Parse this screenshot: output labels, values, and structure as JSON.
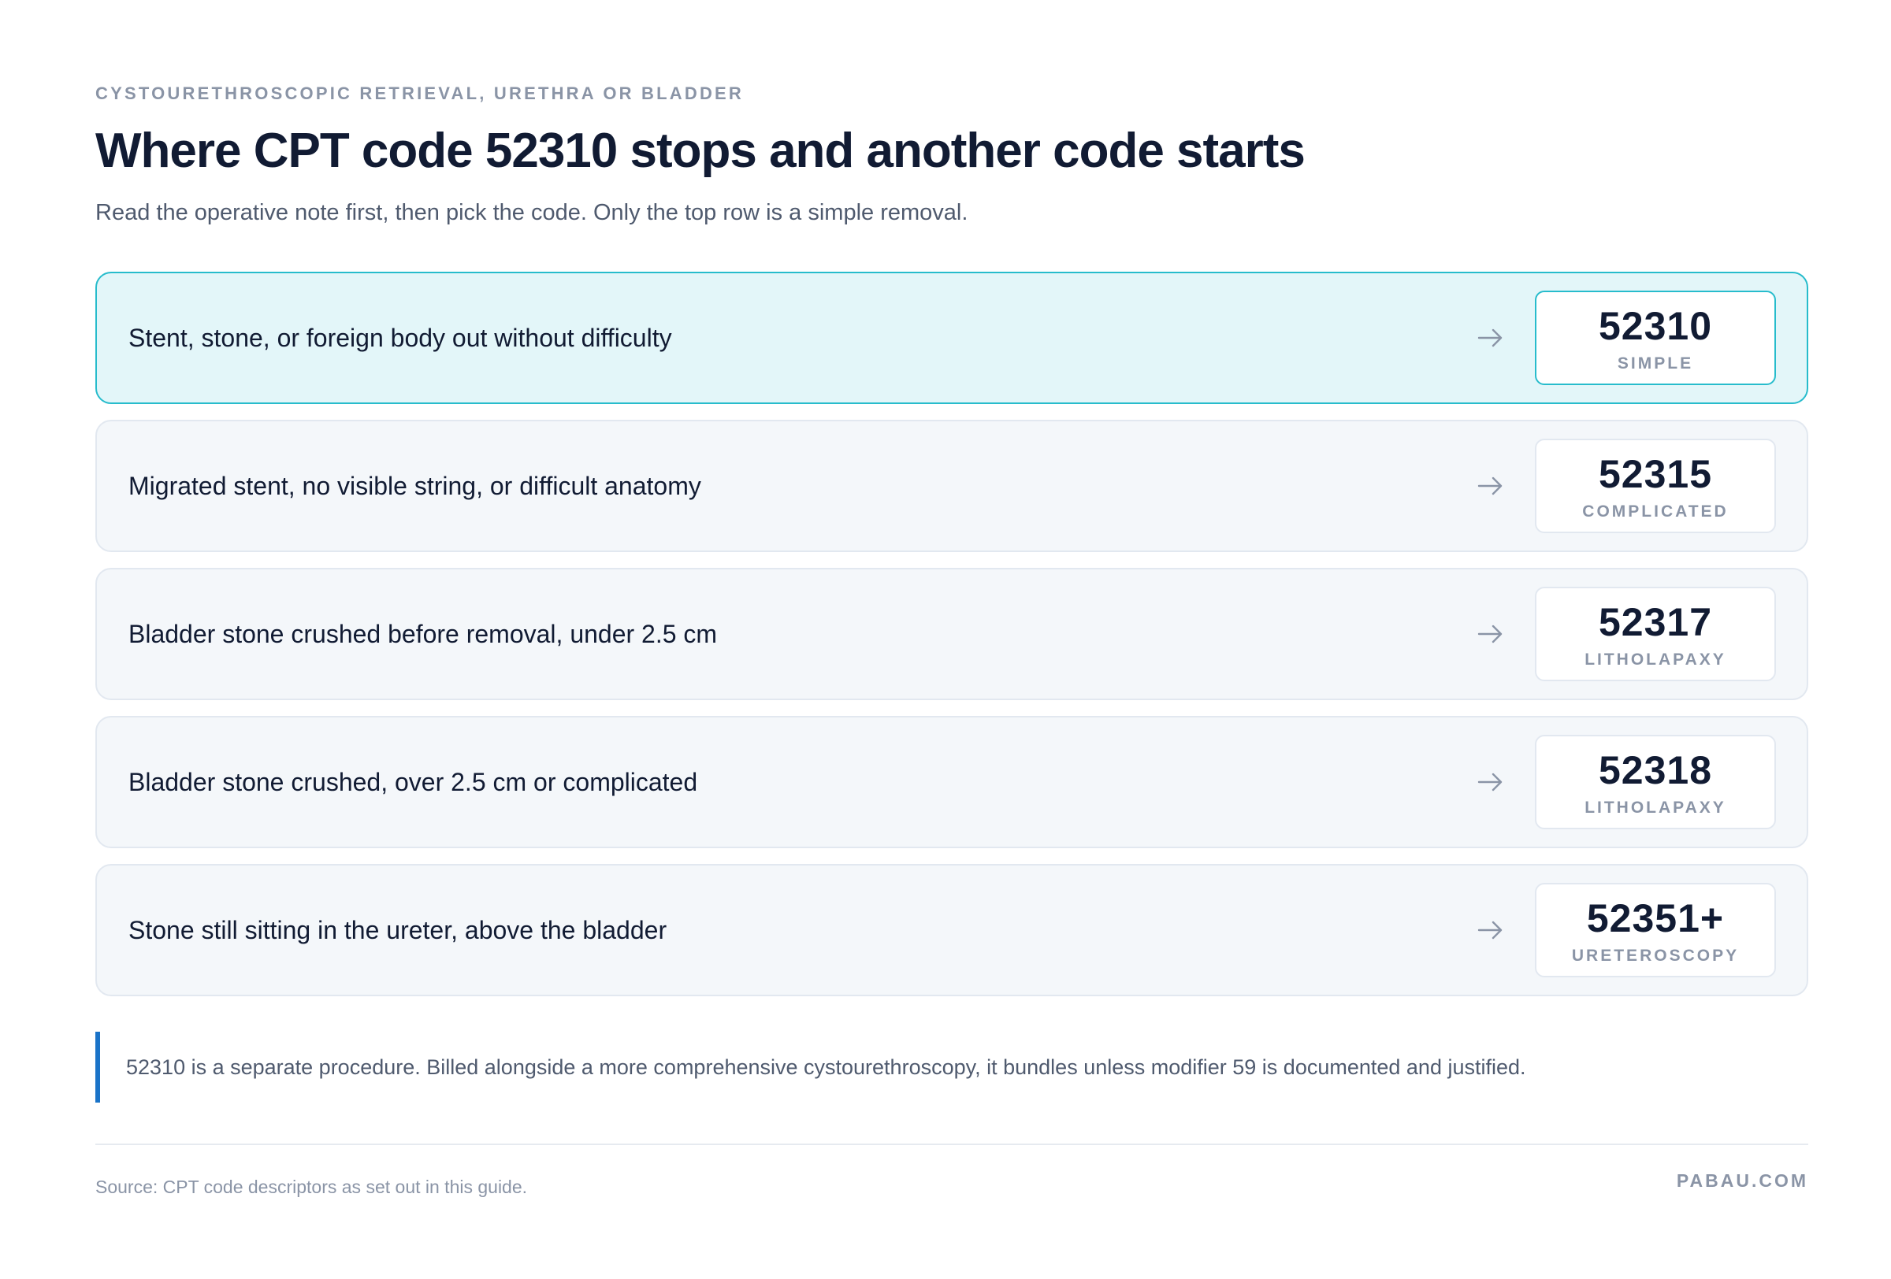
{
  "header": {
    "eyebrow": "CYSTOURETHROSCOPIC RETRIEVAL, URETHRA OR BLADDER",
    "title": "Where CPT code 52310 stops and another code starts",
    "subtitle": "Read the operative note first, then pick the code. Only the top row is a simple removal."
  },
  "rows": [
    {
      "description": "Stent, stone, or foreign body out without difficulty",
      "code": "52310",
      "label": "SIMPLE",
      "highlighted": true
    },
    {
      "description": "Migrated stent, no visible string, or difficult anatomy",
      "code": "52315",
      "label": "COMPLICATED",
      "highlighted": false
    },
    {
      "description": "Bladder stone crushed before removal, under 2.5 cm",
      "code": "52317",
      "label": "LITHOLAPAXY",
      "highlighted": false
    },
    {
      "description": "Bladder stone crushed, over 2.5 cm or complicated",
      "code": "52318",
      "label": "LITHOLAPAXY",
      "highlighted": false
    },
    {
      "description": "Stone still sitting in the ureter, above the bladder",
      "code": "52351+",
      "label": "URETEROSCOPY",
      "highlighted": false
    }
  ],
  "note": {
    "text": "52310 is a separate procedure. Billed alongside a more comprehensive cystourethroscopy, it bundles unless modifier 59 is documented and justified."
  },
  "footer": {
    "source": "Source: CPT code descriptors as set out in this guide.",
    "brand": "PABAU.COM"
  },
  "colors": {
    "accent": "#27bccc",
    "highlight_bg": "#e3f6f9",
    "note_bar": "#1a73c8",
    "muted": "#8a94a6"
  },
  "icons": {
    "row_arrow": "arrow-right-icon"
  }
}
